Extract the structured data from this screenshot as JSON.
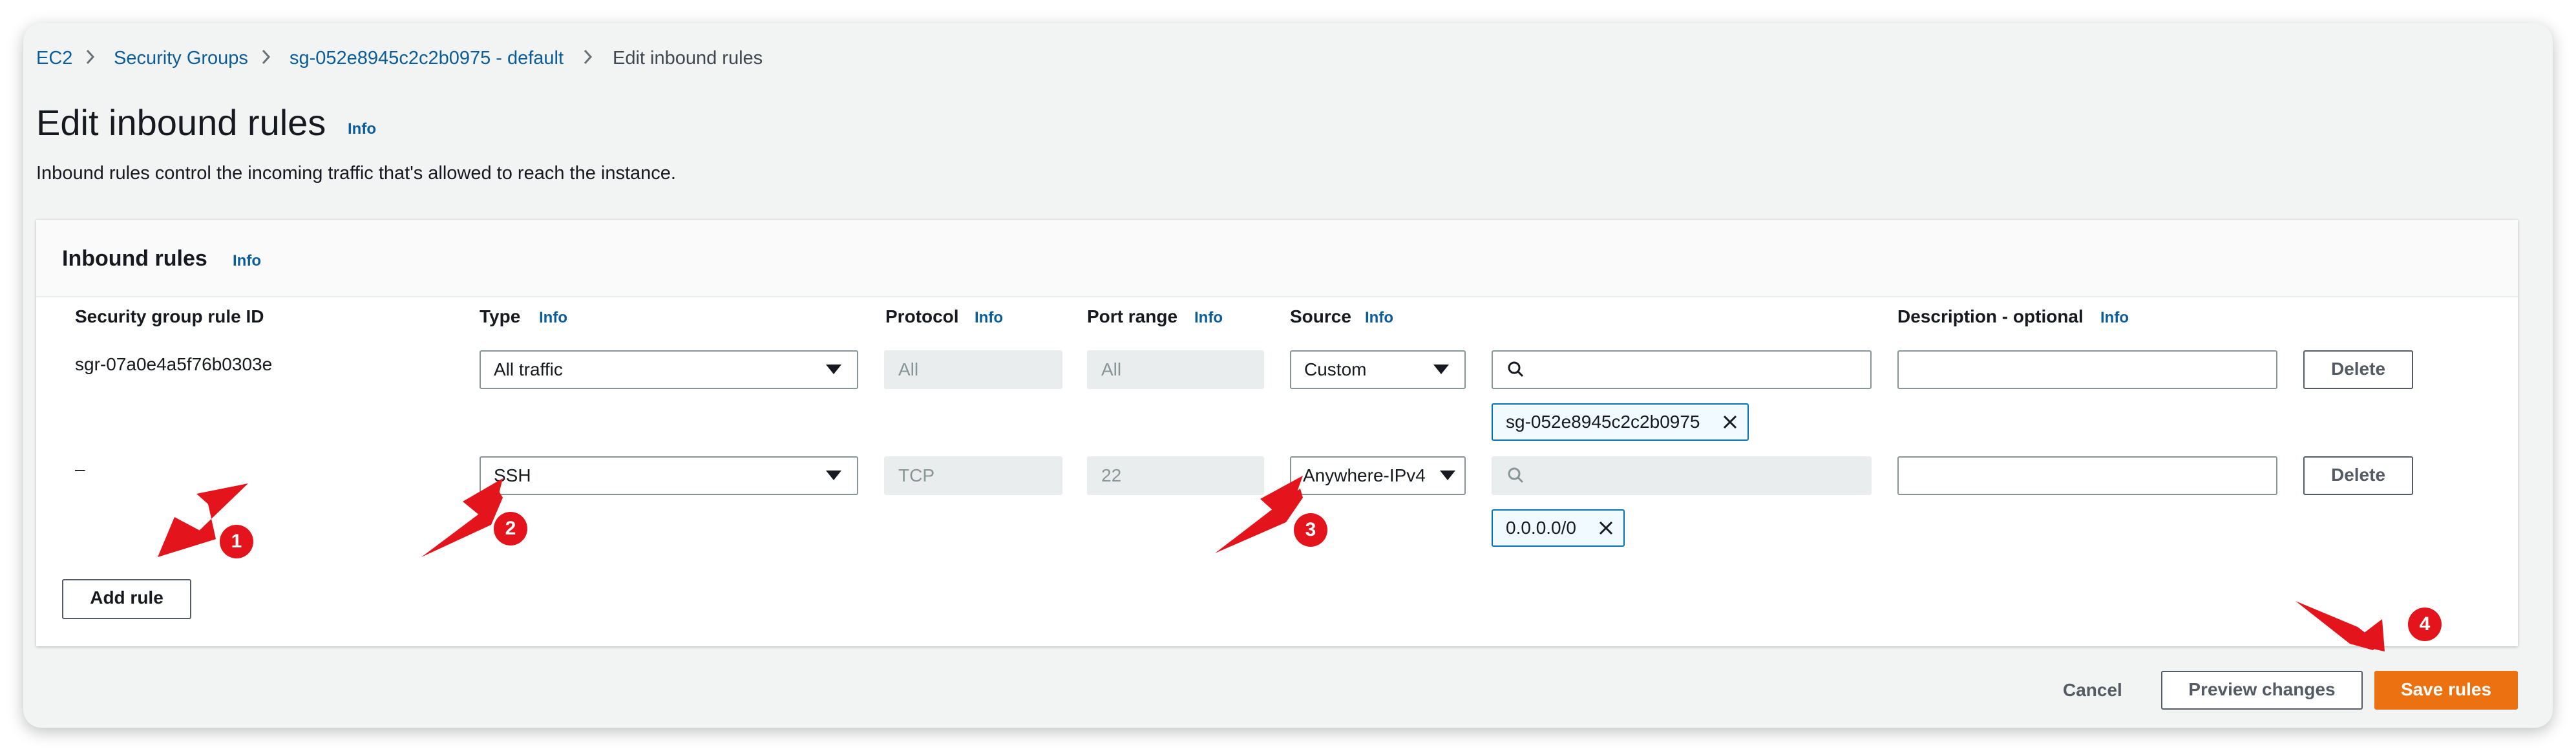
{
  "breadcrumb": {
    "items": [
      "EC2",
      "Security Groups",
      "sg-052e8945c2c2b0975 - default",
      "Edit inbound rules"
    ]
  },
  "page": {
    "title": "Edit inbound rules",
    "title_info": "Info",
    "description": "Inbound rules control the incoming traffic that's allowed to reach the instance."
  },
  "panel": {
    "title": "Inbound rules",
    "title_info": "Info",
    "columns": {
      "rule_id": "Security group rule ID",
      "type": "Type",
      "type_info": "Info",
      "protocol": "Protocol",
      "protocol_info": "Info",
      "port_range": "Port range",
      "port_range_info": "Info",
      "source": "Source",
      "source_info": "Info",
      "description": "Description - optional",
      "description_info": "Info"
    },
    "rows": [
      {
        "rule_id": "sgr-07a0e4a5f76b0303e",
        "type": "All traffic",
        "protocol": "All",
        "port_range": "All",
        "source": "Custom",
        "source_search": "",
        "source_token": "sg-052e8945c2c2b0975",
        "description": "",
        "delete_label": "Delete"
      },
      {
        "rule_id": "–",
        "type": "SSH",
        "protocol": "TCP",
        "port_range": "22",
        "source": "Anywhere-IPv4",
        "source_search": "",
        "source_token": "0.0.0.0/0",
        "description": "",
        "delete_label": "Delete"
      }
    ],
    "add_rule_label": "Add rule"
  },
  "footer": {
    "cancel_label": "Cancel",
    "preview_label": "Preview changes",
    "save_label": "Save rules"
  },
  "annotations": {
    "badges": [
      "1",
      "2",
      "3",
      "4"
    ],
    "color": "#e3141b"
  },
  "colors": {
    "link": "#0b5d9a",
    "primary_button": "#ec7211",
    "token_border": "#0073bb"
  },
  "icons": [
    "chevron-right-icon",
    "caret-down-icon",
    "search-icon",
    "close-icon",
    "arrow-icon"
  ]
}
